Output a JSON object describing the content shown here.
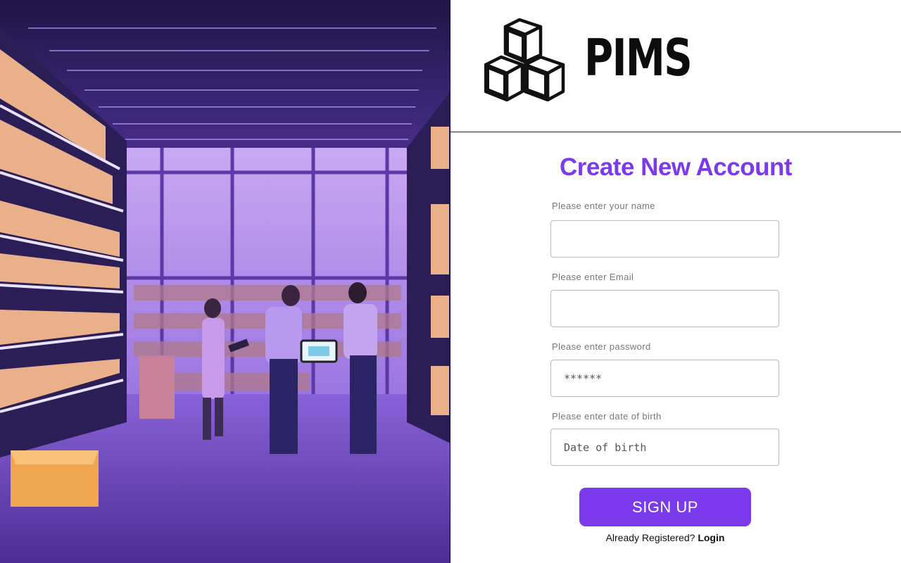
{
  "brand": {
    "name": "PIMS",
    "logo_icon": "stacked-boxes-icon"
  },
  "form": {
    "title": "Create New Account",
    "fields": [
      {
        "label": "Please enter your name",
        "placeholder": "",
        "value": ""
      },
      {
        "label": "Please enter Email",
        "placeholder": "",
        "value": ""
      },
      {
        "label": "Please enter password",
        "placeholder": "******",
        "value": ""
      },
      {
        "label": "Please enter date of birth",
        "placeholder": "Date of birth",
        "value": ""
      }
    ],
    "submit_label": "SIGN UP",
    "already_registered_text": "Already Registered?",
    "login_link_text": "Login"
  },
  "colors": {
    "accent": "#7c3aed",
    "hero_tint": "#8b5cf6"
  }
}
